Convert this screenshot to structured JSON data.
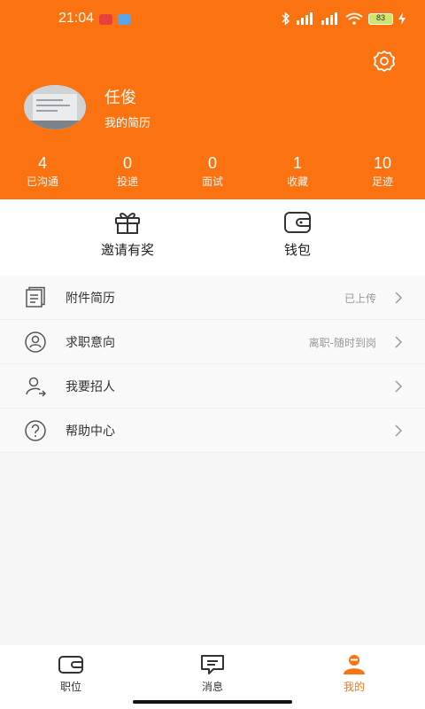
{
  "status_bar": {
    "time": "21:04",
    "battery": "83"
  },
  "profile": {
    "name": "任俊",
    "subtitle": "我的简历"
  },
  "stats": [
    {
      "value": "4",
      "label": "已沟通"
    },
    {
      "value": "0",
      "label": "投递"
    },
    {
      "value": "0",
      "label": "面试"
    },
    {
      "value": "1",
      "label": "收藏"
    },
    {
      "value": "10",
      "label": "足迹"
    }
  ],
  "quick_actions": [
    {
      "label": "邀请有奖",
      "icon": "gift-icon"
    },
    {
      "label": "钱包",
      "icon": "wallet-icon"
    }
  ],
  "menu": [
    {
      "label": "附件简历",
      "value": "已上传",
      "icon": "resume-icon"
    },
    {
      "label": "求职意向",
      "value": "离职-随时到岗",
      "icon": "job-intention-icon"
    },
    {
      "label": "我要招人",
      "value": "",
      "icon": "recruit-icon"
    },
    {
      "label": "帮助中心",
      "value": "",
      "icon": "help-icon"
    }
  ],
  "tabs": [
    {
      "label": "职位",
      "icon": "briefcase-icon",
      "active": false
    },
    {
      "label": "消息",
      "icon": "message-icon",
      "active": false
    },
    {
      "label": "我的",
      "icon": "user-icon",
      "active": true
    }
  ],
  "colors": {
    "accent": "#fb7311",
    "background": "#f7f7f7"
  }
}
